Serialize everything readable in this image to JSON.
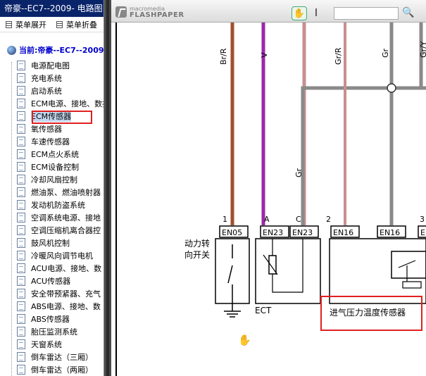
{
  "left_pane": {
    "title": "帝豪--EC7--2009- 电路图",
    "menu": {
      "expand": "菜单展开",
      "collapse": "菜单折叠"
    },
    "root": "当前:帝豪--EC7--2009-",
    "items": [
      "电源配电图",
      "充电系统",
      "启动系统",
      "ECM电源、接地、数据",
      "ECM传感器",
      "氧传感器",
      "车速传感器",
      "ECM点火系统",
      "ECM设备控制",
      "冷却风扇控制",
      "燃油泵、燃油喷射器",
      "发动机防盗系统",
      "空调系统电源、接地",
      "空调压缩机离合器控",
      "鼓风机控制",
      "冷暖风向调节电机",
      "ACU电源、接地、数",
      "ACU传感器",
      "安全带预紧器、充气",
      "ABS电源、接地、数",
      "ABS传感器",
      "胎压监测系统",
      "天窗系统",
      "倒车雷达（三厢）",
      "倒车雷达（两厢）"
    ],
    "selected_index": 4
  },
  "toolbar": {
    "logo_top": "macromedia",
    "logo_bottom": "FLASHPAPER",
    "hand_icon": "✋",
    "text_icon": "I",
    "search_placeholder": "",
    "search_icon": "🔍"
  },
  "diagram": {
    "wires": [
      {
        "label": "Br/R",
        "color": "#a0522d"
      },
      {
        "label": "V",
        "color": "#9b2aa8"
      },
      {
        "label": "Gr/R",
        "color": "#c89090"
      },
      {
        "label": "Gr",
        "color": "#8a8a8a"
      },
      {
        "label": "Gr/Y",
        "color": "#8a8a8a"
      },
      {
        "label": "Gr",
        "color": "#8a8a8a"
      }
    ],
    "pins": [
      "1",
      "A",
      "C",
      "2",
      "",
      "3"
    ],
    "connectors": [
      "EN05",
      "EN23",
      "EN23",
      "EN16",
      "EN16",
      "E"
    ],
    "switch_label": "动力转\n向开关",
    "ect_label": "ECT",
    "sensor_label": "进气压力温度传感器"
  }
}
